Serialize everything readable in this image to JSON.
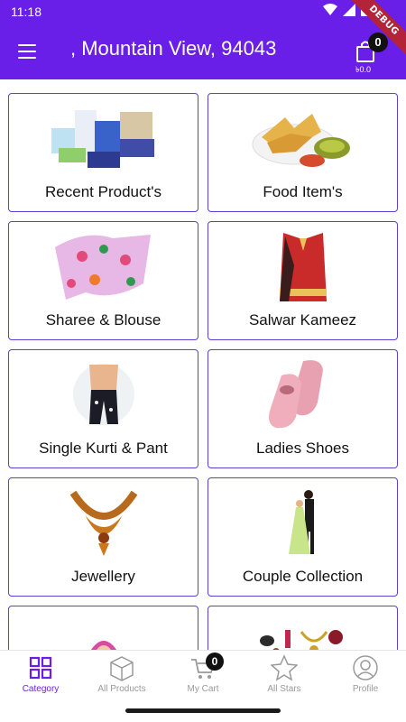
{
  "status_bar": {
    "time": "11:18"
  },
  "app_bar": {
    "title": ", Mountain View, 94043",
    "cart_count": "0",
    "cart_amount": "৳0.0",
    "debug_label": "DEBUG"
  },
  "categories": [
    {
      "label": "Recent Product's"
    },
    {
      "label": "Food Item's"
    },
    {
      "label": "Sharee & Blouse"
    },
    {
      "label": "Salwar Kameez"
    },
    {
      "label": "Single Kurti & Pant"
    },
    {
      "label": "Ladies Shoes"
    },
    {
      "label": "Jewellery"
    },
    {
      "label": "Couple Collection"
    },
    {
      "label": ""
    },
    {
      "label": ""
    }
  ],
  "bottom_nav": {
    "items": [
      {
        "label": "Category",
        "icon": "category-icon"
      },
      {
        "label": "All Products",
        "icon": "box-icon"
      },
      {
        "label": "My Cart",
        "icon": "cart-icon"
      },
      {
        "label": "All Stars",
        "icon": "star-icon"
      },
      {
        "label": "Profile",
        "icon": "profile-icon"
      }
    ],
    "cart_badge": "0"
  },
  "colors": {
    "primary": "#6a1fe8",
    "card_border": "#5a3fd8",
    "inactive": "#9a9a9a"
  }
}
